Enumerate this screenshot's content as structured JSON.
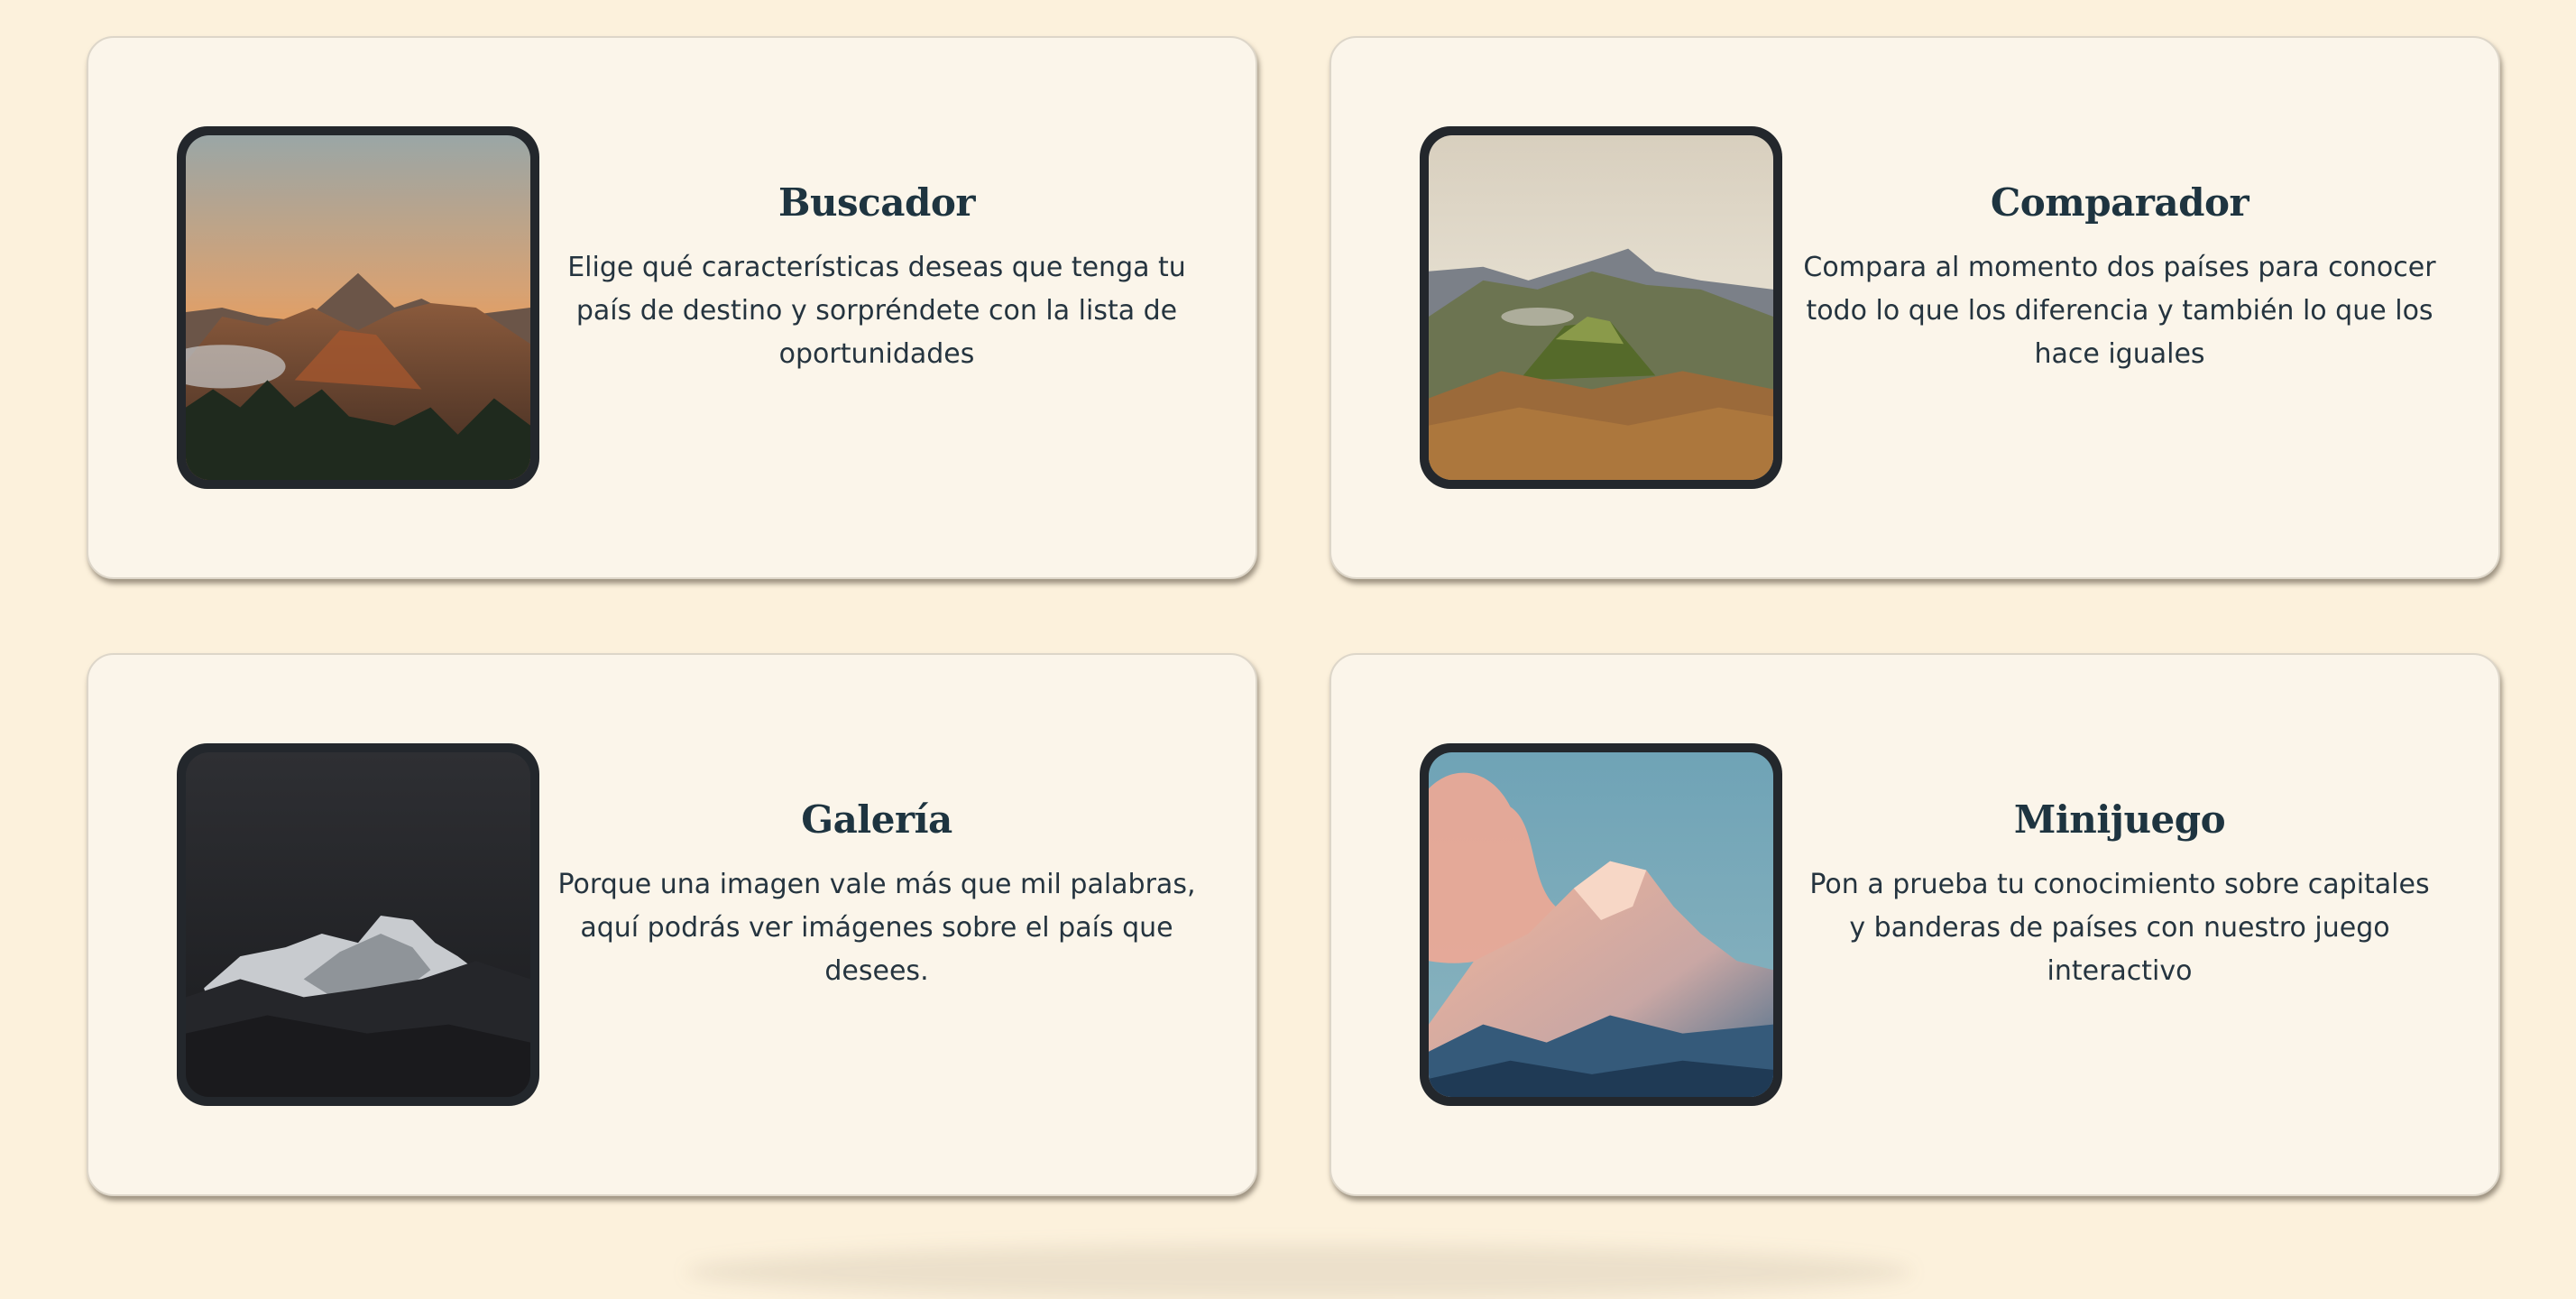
{
  "cards": [
    {
      "title": "Buscador",
      "description": "Elige qué características deseas que tenga tu país de destino y sorpréndete con la lista de oportunidades",
      "image": "volcano-sunset"
    },
    {
      "title": "Comparador",
      "description": "Compara al momento dos países para conocer todo lo que los diferencia y también lo que los hace iguales",
      "image": "volcano-crater-landscape"
    },
    {
      "title": "Galería",
      "description": "Porque una imagen vale más que mil palabras, aquí podrás ver imágenes sobre el país que desees.",
      "image": "snowy-peak-night"
    },
    {
      "title": "Minijuego",
      "description": "Pon a prueba tu conocimiento sobre capitales y banderas de países con nuestro juego interactivo",
      "image": "pink-mountain-sunrise"
    }
  ]
}
